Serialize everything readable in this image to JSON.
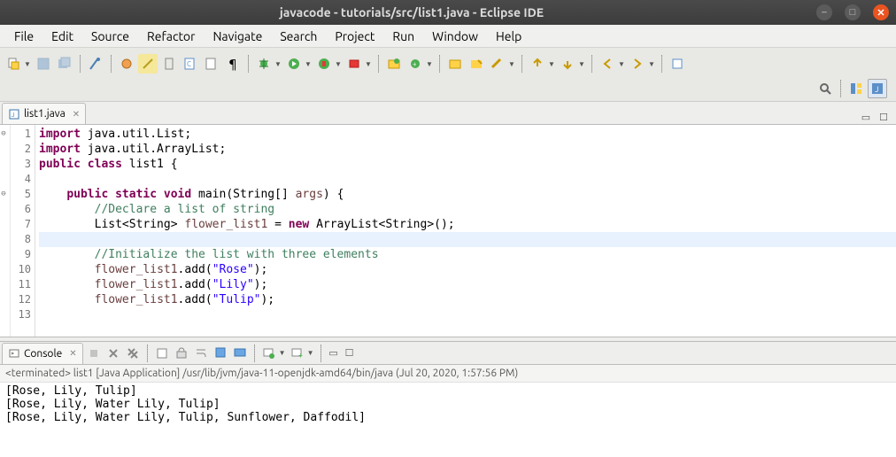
{
  "window": {
    "title": "javacode - tutorials/src/list1.java - Eclipse IDE"
  },
  "menus": [
    "File",
    "Edit",
    "Source",
    "Refactor",
    "Navigate",
    "Search",
    "Project",
    "Run",
    "Window",
    "Help"
  ],
  "editor": {
    "tab_label": "list1.java",
    "lines": [
      {
        "n": "1",
        "fold": "⊖",
        "html": "<span class='kw'>import</span> java.util.List;"
      },
      {
        "n": "2",
        "fold": "",
        "html": "<span class='kw'>import</span> java.util.ArrayList;"
      },
      {
        "n": "3",
        "fold": "",
        "html": "<span class='kw'>public class</span> <span class='typ'>list1</span> {"
      },
      {
        "n": "4",
        "fold": "",
        "html": ""
      },
      {
        "n": "5",
        "fold": "⊖",
        "html": "    <span class='kw'>public static void</span> main(String[] <span class='arg'>args</span>) {"
      },
      {
        "n": "6",
        "fold": "",
        "html": "        <span class='cm'>//Declare a list of string</span>"
      },
      {
        "n": "7",
        "fold": "",
        "html": "        List&lt;String&gt; <span class='id'>flower_list1</span> = <span class='kw'>new</span> ArrayList&lt;String&gt;();"
      },
      {
        "n": "8",
        "fold": "",
        "html": "",
        "hl": true
      },
      {
        "n": "9",
        "fold": "",
        "html": "        <span class='cm'>//Initialize the list with three elements</span>"
      },
      {
        "n": "10",
        "fold": "",
        "html": "        <span class='id'>flower_list1</span>.add(<span class='str'>\"Rose\"</span>);"
      },
      {
        "n": "11",
        "fold": "",
        "html": "        <span class='id'>flower_list1</span>.add(<span class='str'>\"Lily\"</span>);"
      },
      {
        "n": "12",
        "fold": "",
        "html": "        <span class='id'>flower_list1</span>.add(<span class='str'>\"Tulip\"</span>);"
      },
      {
        "n": "13",
        "fold": "",
        "html": ""
      }
    ]
  },
  "console": {
    "tab_label": "Console",
    "status": "<terminated> list1 [Java Application] /usr/lib/jvm/java-11-openjdk-amd64/bin/java (Jul 20, 2020, 1:57:56 PM)",
    "output": "[Rose, Lily, Tulip]\n[Rose, Lily, Water Lily, Tulip]\n[Rose, Lily, Water Lily, Tulip, Sunflower, Daffodil]"
  }
}
